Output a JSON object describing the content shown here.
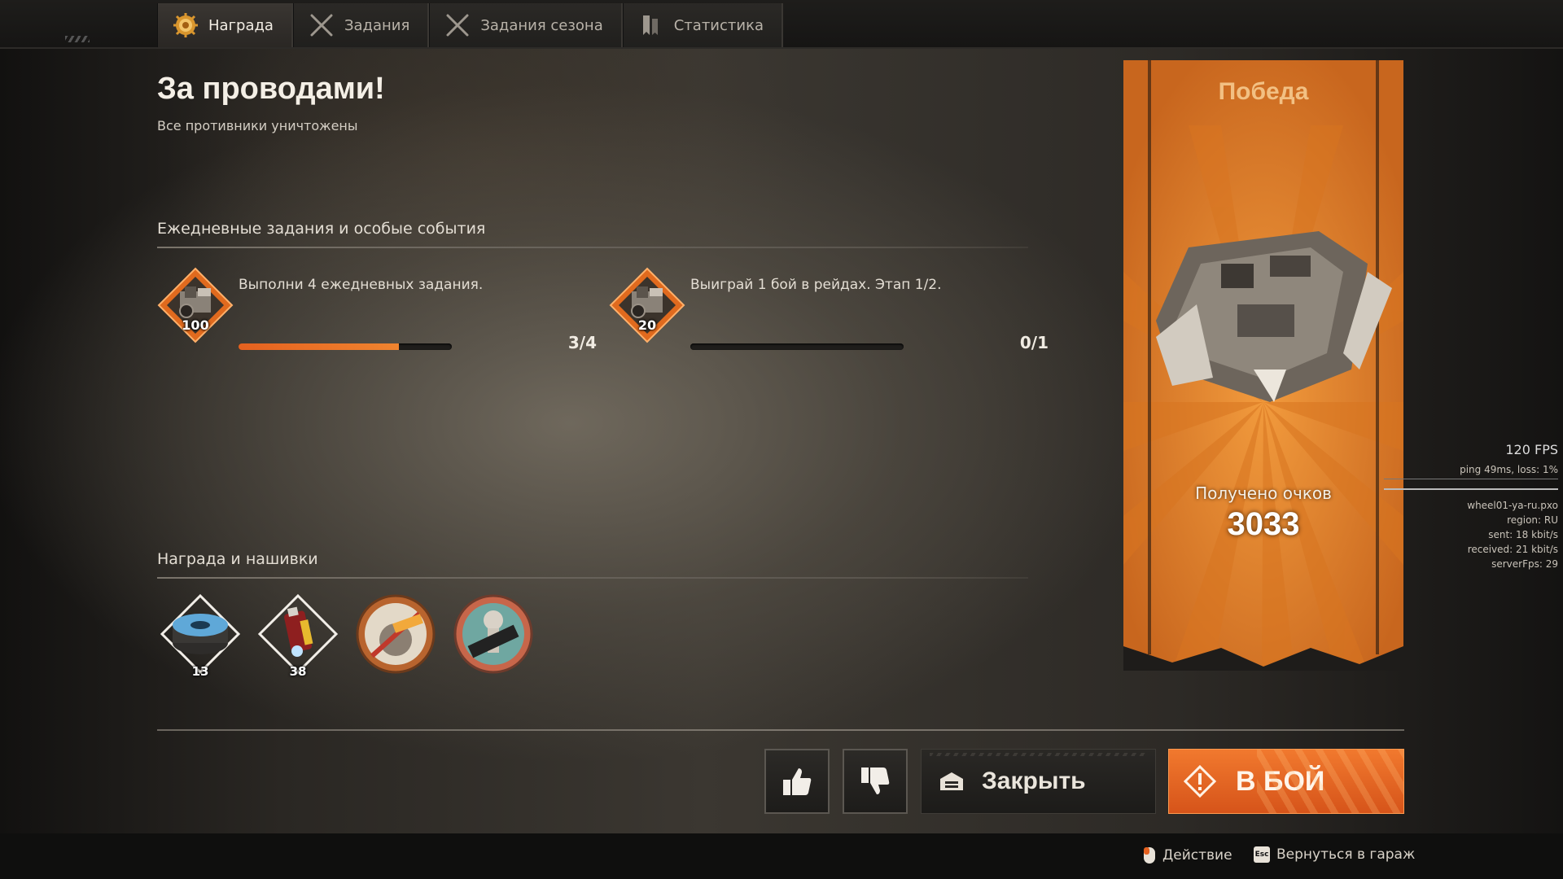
{
  "tabs": [
    {
      "label": "Награда",
      "icon": "reward-gear-icon",
      "active": true
    },
    {
      "label": "Задания",
      "icon": "crossed-swords-icon",
      "active": false
    },
    {
      "label": "Задания сезона",
      "icon": "crossed-swords-icon",
      "active": false
    },
    {
      "label": "Статистика",
      "icon": "stats-bookmark-icon",
      "active": false
    }
  ],
  "battle": {
    "title": "За проводами!",
    "subtitle": "Все противники уничтожены"
  },
  "daily": {
    "heading": "Ежедневные задания и особые события",
    "quests": [
      {
        "text": "Выполни 4 ежедневных задания.",
        "reward": "100",
        "progress": 0.75,
        "count": "3/4"
      },
      {
        "text": "Выиграй 1 бой в рейдах. Этап 1/2.",
        "reward": "20",
        "progress": 0.0,
        "count": "0/1"
      }
    ]
  },
  "rewards": {
    "heading": "Награда и нашивки",
    "items": [
      {
        "name": "wire-coil-icon",
        "count": "13"
      },
      {
        "name": "battery-icon",
        "count": "38"
      },
      {
        "name": "killjoy-badge-icon",
        "count": ""
      },
      {
        "name": "mvp-badge-icon",
        "count": ""
      }
    ]
  },
  "result": {
    "label": "Победа",
    "points_label": "Получено очков",
    "points": "3033"
  },
  "net": {
    "fps": "120 FPS",
    "ping": "ping 49ms, loss:  1%",
    "server": "wheel01-ya-ru.pxo",
    "region": "region: RU",
    "sent": "sent: 18 kbit/s",
    "received": "received: 21 kbit/s",
    "server_fps": "serverFps: 29"
  },
  "actions": {
    "close": "Закрыть",
    "fight": "В БОЙ"
  },
  "hints": {
    "action": "Действие",
    "esc_key": "Esc",
    "back": "Вернуться в гараж"
  },
  "colors": {
    "accent": "#e5611f",
    "banner": "#e0822a"
  }
}
